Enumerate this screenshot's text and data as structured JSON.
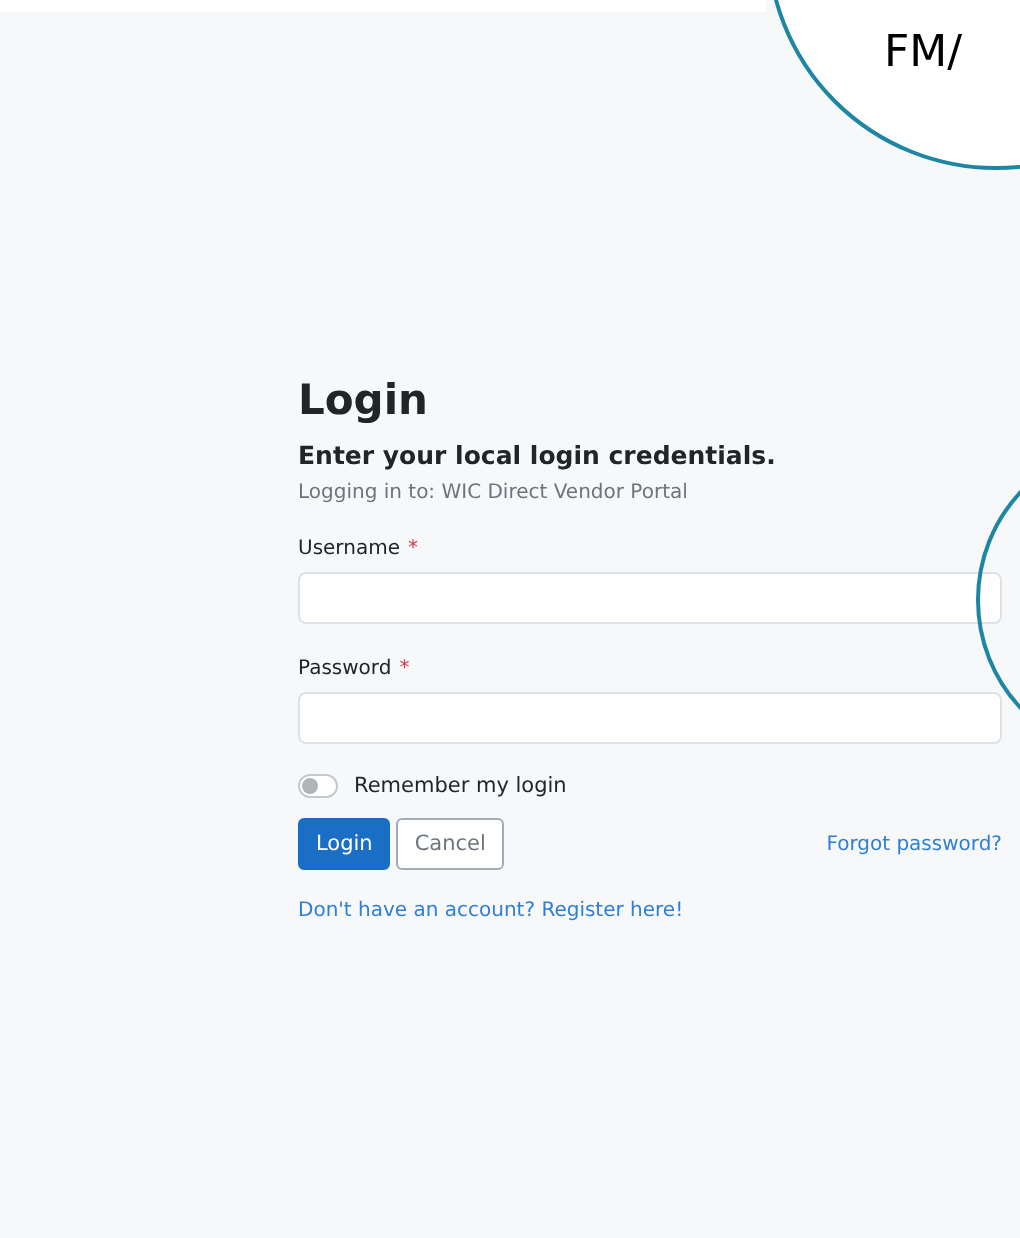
{
  "callout_text": "FM/",
  "login": {
    "title": "Login",
    "subtitle": "Enter your local login credentials.",
    "context": "Logging in to: WIC Direct Vendor Portal",
    "fields": [
      {
        "label": "Username",
        "required_mark": "*"
      },
      {
        "label": "Password",
        "required_mark": "*"
      }
    ],
    "remember": {
      "label": "Remember my login",
      "on": false
    },
    "buttons": [
      {
        "label": "Login",
        "kind": "primary"
      },
      {
        "label": "Cancel",
        "kind": "secondary"
      }
    ],
    "forgot_link": "Forgot password?",
    "register_link": "Don't have an account? Register here!"
  }
}
